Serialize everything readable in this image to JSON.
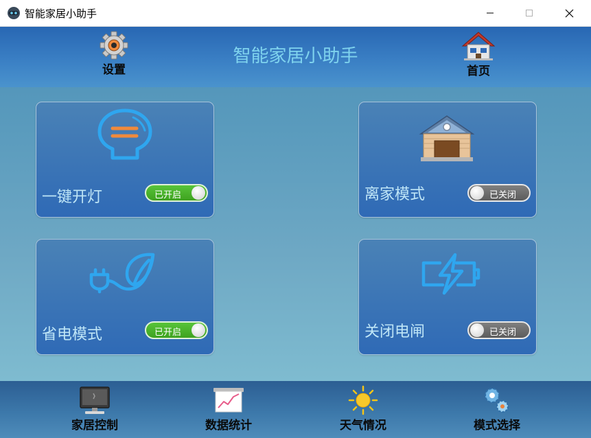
{
  "window": {
    "title": "智能家居小助手"
  },
  "header": {
    "title": "智能家居小助手",
    "settings_label": "设置",
    "home_label": "首页"
  },
  "cards": [
    {
      "label": "一键开灯",
      "icon": "lightbulb-icon",
      "toggle_text": "已开启",
      "on": true
    },
    {
      "label": "离家模式",
      "icon": "house-icon",
      "toggle_text": "已关闭",
      "on": false
    },
    {
      "label": "省电模式",
      "icon": "plug-leaf-icon",
      "toggle_text": "已开启",
      "on": true
    },
    {
      "label": "关闭电闸",
      "icon": "battery-bolt-icon",
      "toggle_text": "已关闭",
      "on": false
    }
  ],
  "bottom_nav": [
    {
      "label": "家居控制",
      "icon": "monitor-icon"
    },
    {
      "label": "数据统计",
      "icon": "chart-board-icon"
    },
    {
      "label": "天气情况",
      "icon": "sun-icon"
    },
    {
      "label": "模式选择",
      "icon": "gears-icon"
    }
  ],
  "colors": {
    "header": "#2f6fb8",
    "title": "#7fd3ee",
    "card": "#3a74b6",
    "toggle_on": "#4cb82a",
    "toggle_off": "#6e6e6e"
  }
}
